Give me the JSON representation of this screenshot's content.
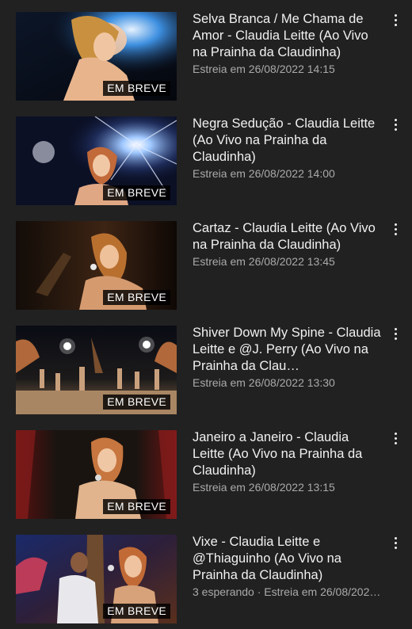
{
  "videos": [
    {
      "title": "Selva Branca / Me Chama de Amor - Claudia Leitte (Ao Vivo na Prainha da Claudinha)",
      "meta": "Estreia em 26/08/2022 14:15",
      "badge": "EM BREVE",
      "menu_icon": "more-vert-icon"
    },
    {
      "title": "Negra Sedução - Claudia Leitte (Ao Vivo na Prainha da Claudinha)",
      "meta": "Estreia em 26/08/2022 14:00",
      "badge": "EM BREVE",
      "menu_icon": "more-vert-icon"
    },
    {
      "title": "Cartaz - Claudia Leitte (Ao Vivo na Prainha da Claudinha)",
      "meta": "Estreia em 26/08/2022 13:45",
      "badge": "EM BREVE",
      "menu_icon": "more-vert-icon"
    },
    {
      "title": "Shiver Down My Spine - Claudia Leitte e @J. Perry (Ao Vivo na Prainha da Clau…",
      "meta": "Estreia em 26/08/2022 13:30",
      "badge": "EM BREVE",
      "menu_icon": "more-vert-icon"
    },
    {
      "title": "Janeiro a Janeiro - Claudia Leitte (Ao Vivo na Prainha da Claudinha)",
      "meta": "Estreia em 26/08/2022 13:15",
      "badge": "EM BREVE",
      "menu_icon": "more-vert-icon"
    },
    {
      "title": "Vixe - Claudia Leitte e @Thiaguinho (Ao Vivo na Prainha da Claudinha)",
      "meta": "3 esperando · Estreia em 26/08/2022…",
      "badge": "EM BREVE",
      "menu_icon": "more-vert-icon"
    }
  ],
  "colors": {
    "background": "#212121",
    "title": "#f1f1f1",
    "meta": "#aaaaaa",
    "badge_bg": "#000000"
  }
}
